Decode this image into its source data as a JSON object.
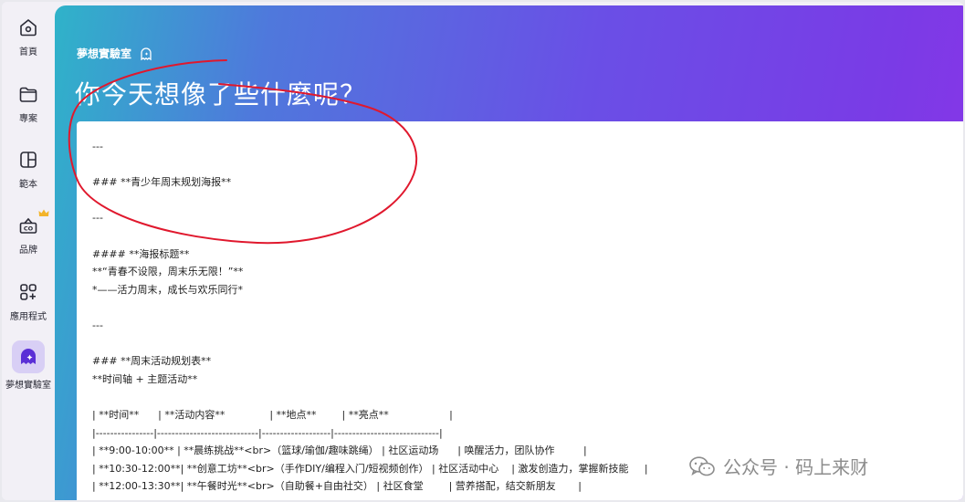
{
  "sidebar": {
    "items": [
      {
        "label": "首頁",
        "icon": "home-icon"
      },
      {
        "label": "專案",
        "icon": "folder-icon"
      },
      {
        "label": "範本",
        "icon": "template-icon"
      },
      {
        "label": "品牌",
        "icon": "brand-icon"
      },
      {
        "label": "應用程式",
        "icon": "apps-icon"
      },
      {
        "label": "夢想實驗室",
        "icon": "dream-lab-icon"
      }
    ],
    "active_index": 5
  },
  "header": {
    "brand": "夢想實驗室",
    "title": "你今天想像了些什麼呢？"
  },
  "document": {
    "lines": [
      "---",
      "",
      "### **青少年周末规划海报**",
      "",
      "---",
      "",
      "#### **海报标题**",
      "**“青春不设限，周末乐无限！”**",
      "*——活力周末，成长与欢乐同行*",
      "",
      "---",
      "",
      "### **周末活动规划表**",
      "**时间轴 + 主题活动**",
      "",
      "| **时间**      | **活动内容**              | **地点**        | **亮点**                   |",
      "|----------------|----------------------------|-------------------|-----------------------------|",
      "| **9:00-10:00** | **晨练挑战**<br>（篮球/瑜伽/趣味跳绳） | 社区运动场      | 唤醒活力，团队协作         |",
      "| **10:30-12:00**| **创意工坊**<br>（手作DIY/编程入门/短视频创作） | 社区活动中心    | 激发创造力，掌握新技能     |",
      "| **12:00-13:30**| **午餐时光**<br>（自助餐+自由社交） | 社区食堂        | 营养搭配，结交新朋友       |"
    ]
  },
  "watermark": {
    "text": "公众号 · 码上来财",
    "icon": "wechat-icon"
  },
  "colors": {
    "accent": "#7a3be6",
    "active_nav_bg": "#d8cff5",
    "annotation": "#e0182d"
  }
}
